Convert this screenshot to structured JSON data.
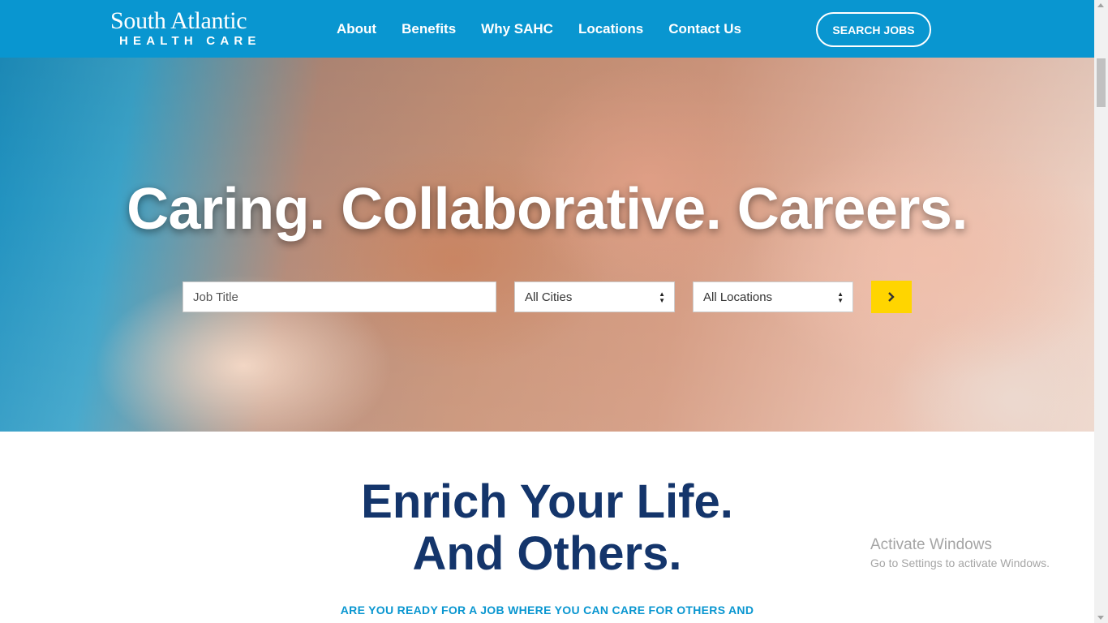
{
  "brand": {
    "logo_top": "South Atlantic",
    "logo_bottom": "HEALTH CARE"
  },
  "nav": {
    "items": [
      {
        "label": "About"
      },
      {
        "label": "Benefits"
      },
      {
        "label": "Why SAHC"
      },
      {
        "label": "Locations"
      },
      {
        "label": "Contact Us"
      }
    ],
    "search_jobs_label": "SEARCH JOBS"
  },
  "hero": {
    "title": "Caring. Collaborative. Careers.",
    "job_title_placeholder": "Job Title",
    "cities_selected": "All Cities",
    "locations_selected": "All Locations",
    "go_icon": "chevron-right-icon"
  },
  "content": {
    "headline_line1": "Enrich Your Life.",
    "headline_line2": "And Others.",
    "subline": "ARE YOU READY FOR A JOB WHERE YOU CAN CARE FOR OTHERS AND"
  },
  "watermark": {
    "title": "Activate Windows",
    "subtitle": "Go to Settings to activate Windows."
  },
  "colors": {
    "header_blue": "#0996d0",
    "navy": "#14356b",
    "button_yellow": "#ffd500"
  }
}
